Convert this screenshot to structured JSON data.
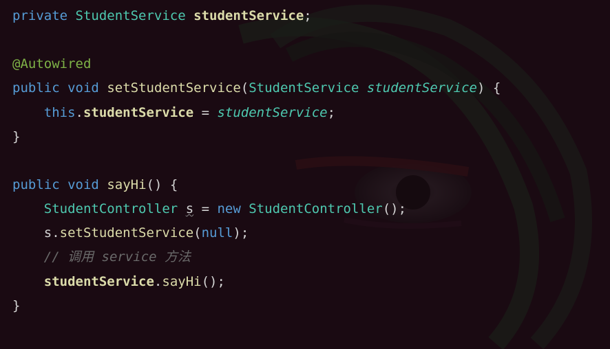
{
  "lines": {
    "l1": {
      "private": "private",
      "type": "StudentService",
      "field": "studentService",
      "semi": ";"
    },
    "l3": {
      "annotation": "@Autowired"
    },
    "l4": {
      "public": "public",
      "void": "void",
      "method": "setStudentService",
      "lparen": "(",
      "ptype": "StudentService",
      "pname": "studentService",
      "rparen": ")",
      "brace": " {"
    },
    "l5": {
      "indent": "    ",
      "this": "this",
      "dot": ".",
      "field": "studentService",
      "eq": " = ",
      "param": "studentService",
      "semi": ";"
    },
    "l6": {
      "brace": "}"
    },
    "l8": {
      "public": "public",
      "void": "void",
      "method": "sayHi",
      "parens": "()",
      "brace": " {"
    },
    "l9": {
      "indent": "    ",
      "type1": "StudentController",
      "var": "s",
      "eq": " = ",
      "new": "new",
      "type2": "StudentController",
      "parens": "()",
      "semi": ";"
    },
    "l10": {
      "indent": "    ",
      "var": "s",
      "dot": ".",
      "method": "setStudentService",
      "lparen": "(",
      "null": "null",
      "rparen": ")",
      "semi": ";"
    },
    "l11": {
      "indent": "    ",
      "comment": "// 调用 service 方法"
    },
    "l12": {
      "indent": "    ",
      "field": "studentService",
      "dot": ".",
      "method": "sayHi",
      "parens": "()",
      "semi": ";"
    },
    "l13": {
      "brace": "}"
    }
  }
}
